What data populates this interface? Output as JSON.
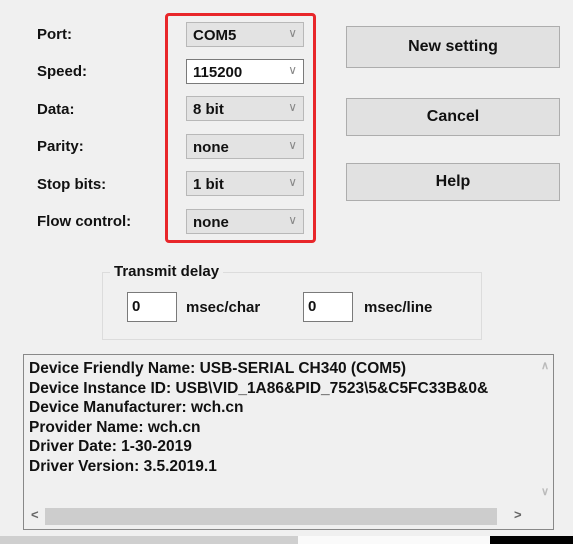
{
  "settings": [
    {
      "label": "Port:",
      "value": "COM5"
    },
    {
      "label": "Speed:",
      "value": "115200"
    },
    {
      "label": "Data:",
      "value": "8 bit"
    },
    {
      "label": "Parity:",
      "value": "none"
    },
    {
      "label": "Stop bits:",
      "value": "1 bit"
    },
    {
      "label": "Flow control:",
      "value": "none"
    }
  ],
  "buttons": {
    "new_setting": "New setting",
    "cancel": "Cancel",
    "help": "Help"
  },
  "transmit_delay": {
    "title": "Transmit delay",
    "char_value": "0",
    "char_unit": "msec/char",
    "line_value": "0",
    "line_unit": "msec/line"
  },
  "device_info": [
    "Device Friendly Name: USB-SERIAL CH340 (COM5)",
    "Device Instance ID: USB\\VID_1A86&PID_7523\\5&C5FC33B&0&",
    "Device Manufacturer: wch.cn",
    "Provider Name: wch.cn",
    "Driver Date: 1-30-2019",
    "Driver Version: 3.5.2019.1"
  ],
  "highlight_color": "#e8262a"
}
